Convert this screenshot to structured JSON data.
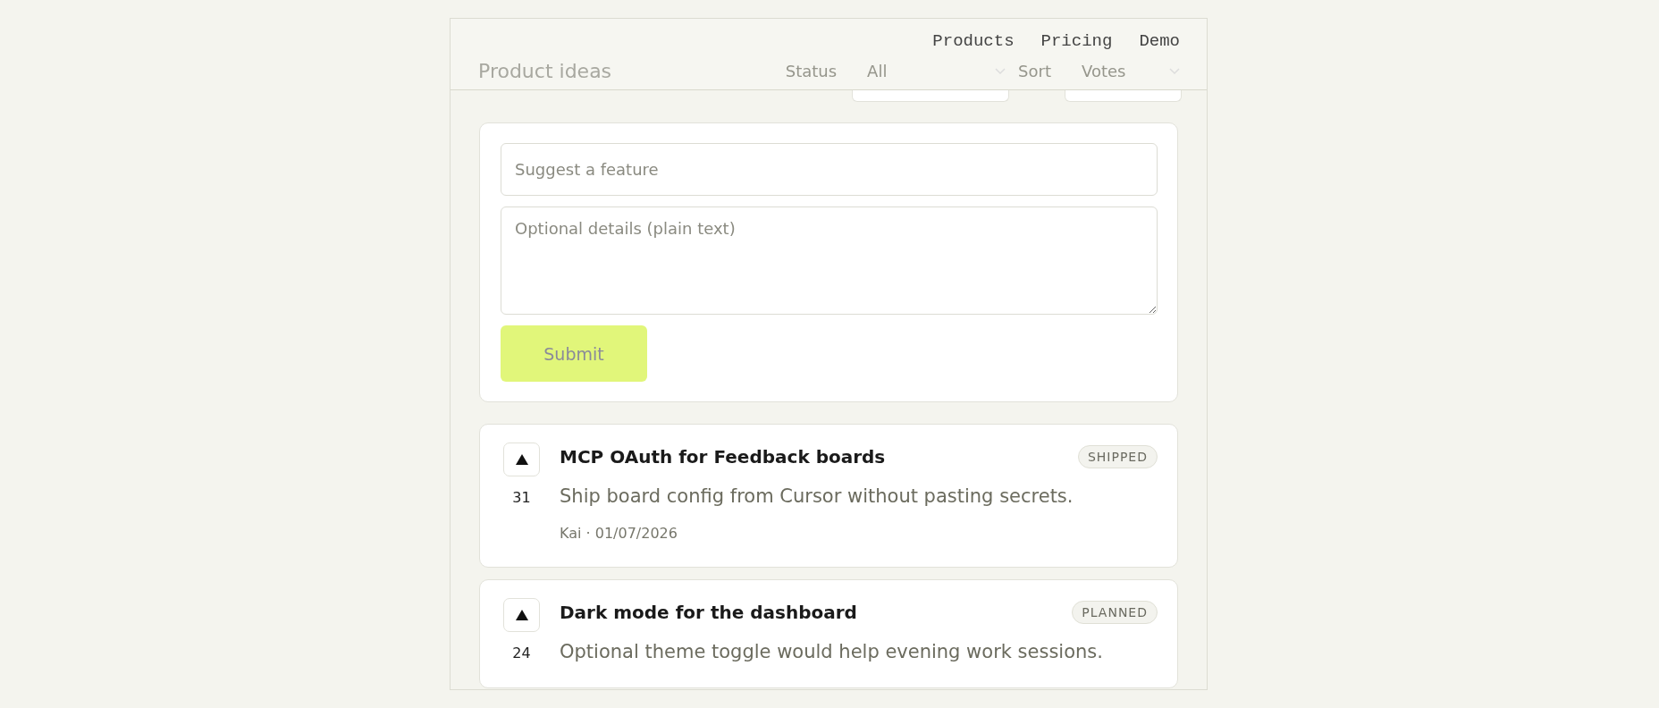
{
  "nav": {
    "links": [
      "Products",
      "Pricing",
      "Demo"
    ]
  },
  "toolbar": {
    "title": "Product ideas",
    "filters": [
      {
        "label": "Status",
        "value": "All"
      },
      {
        "label": "Sort",
        "value": "Votes"
      }
    ]
  },
  "form": {
    "title_placeholder": "Suggest a feature",
    "details_placeholder": "Optional details (plain text)",
    "submit": "Submit"
  },
  "ideas": [
    {
      "votes": "31",
      "title": "MCP OAuth for Feedback boards",
      "description": "Ship board config from Cursor without pasting secrets.",
      "meta": "Kai · 01/07/2026",
      "status": "SHIPPED"
    },
    {
      "votes": "24",
      "title": "Dark mode for the dashboard",
      "description": "Optional theme toggle would help evening work sessions.",
      "status": "PLANNED"
    }
  ]
}
